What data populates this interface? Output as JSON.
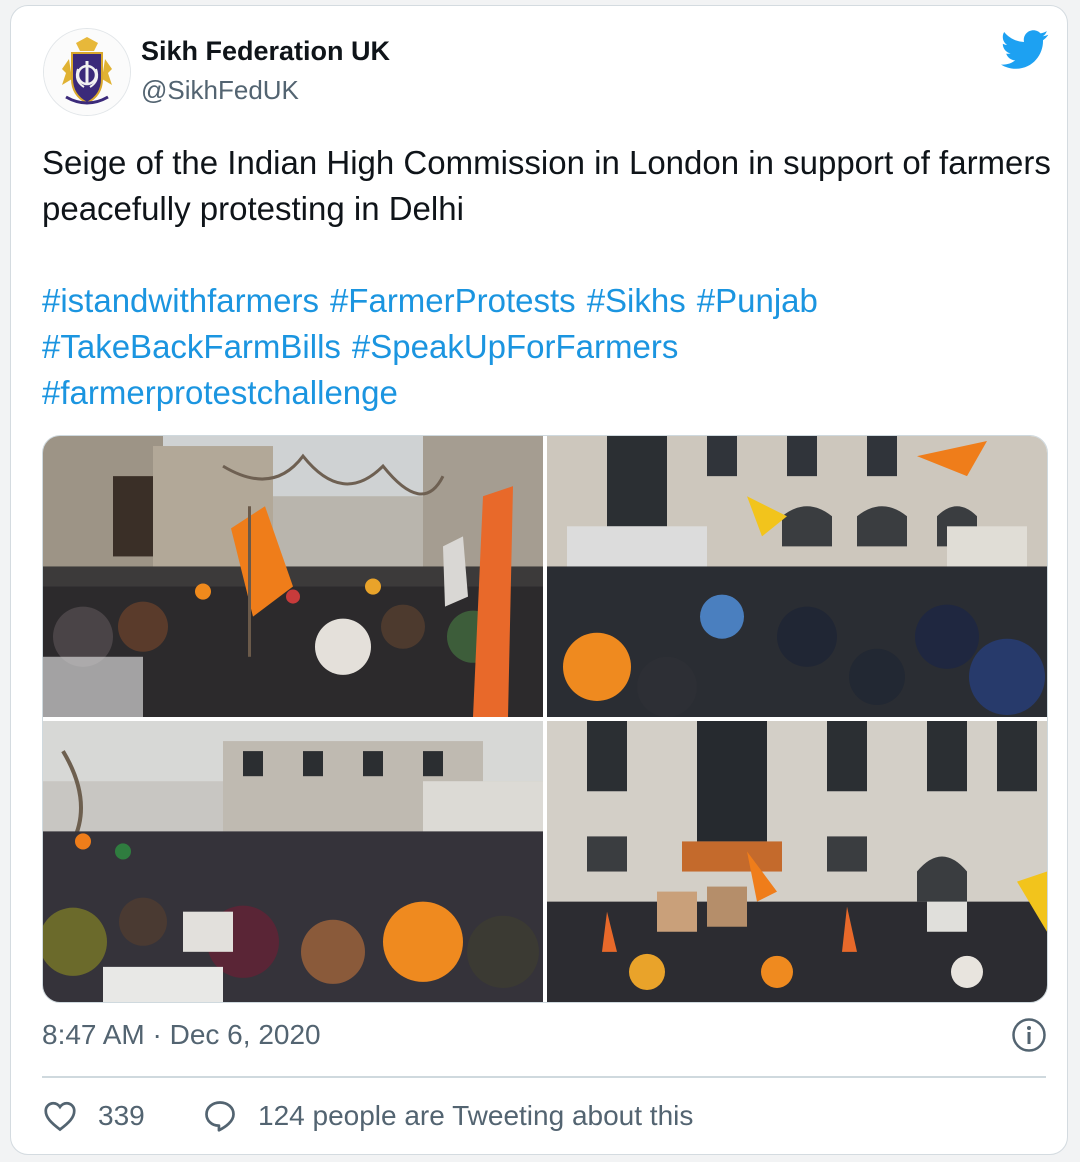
{
  "account": {
    "name": "Sikh Federation UK",
    "handle": "@SikhFedUK",
    "avatar_icon": "sikh-federation-crest-logo"
  },
  "brand": {
    "icon": "twitter-bird-icon",
    "color": "#1da1f2"
  },
  "tweet": {
    "text": "Seige of the Indian High Commission in London in support of farmers peacefully protesting in Delhi",
    "hashtags": [
      "#istandwithfarmers",
      "#FarmerProtests",
      "#Sikhs",
      "#Punjab",
      "#TakeBackFarmBills",
      "#SpeakUpForFarmers",
      "#farmerprotestchallenge"
    ],
    "photos": [
      "protest-street-crowd-photo",
      "protest-building-front-photo",
      "protest-crowd-placards-photo",
      "protest-high-commission-photo"
    ]
  },
  "meta": {
    "timestamp": "8:47 AM · Dec 6, 2020",
    "info_icon": "info-icon"
  },
  "actions": {
    "like_icon": "heart-icon",
    "like_count": "339",
    "reply_icon": "speech-bubble-icon",
    "conversation_text": "124 people are Tweeting about this"
  },
  "colors": {
    "link": "#1b95e0",
    "secondary_text": "#536471",
    "saffron": "#ef7d1a"
  }
}
